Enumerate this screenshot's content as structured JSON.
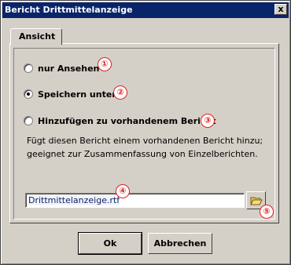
{
  "window": {
    "title": "Bericht Drittmittelanzeige",
    "close_label": "x"
  },
  "tab": {
    "label": "Ansicht"
  },
  "options": [
    {
      "label": "nur Ansehen",
      "checked": false,
      "marker": "①"
    },
    {
      "label": "Speichern unter",
      "checked": true,
      "marker": "②"
    },
    {
      "label": "Hinzufügen zu vorhandenem Bericht",
      "checked": false,
      "marker": "③"
    }
  ],
  "description": "Fügt diesen Bericht einem vorhandenen Bericht hinzu; geeignet zur Zusammenfassung von Einzelberichten.",
  "file": {
    "value": "Drittmittelanzeige.rtf",
    "marker": "④",
    "browse_marker": "⑤",
    "browse_icon": "folder-open-icon"
  },
  "buttons": {
    "ok": "Ok",
    "cancel": "Abbrechen"
  },
  "colors": {
    "title_bar": "#0a246a",
    "dialog_bg": "#d4d0c8",
    "marker_red": "#e02020"
  }
}
